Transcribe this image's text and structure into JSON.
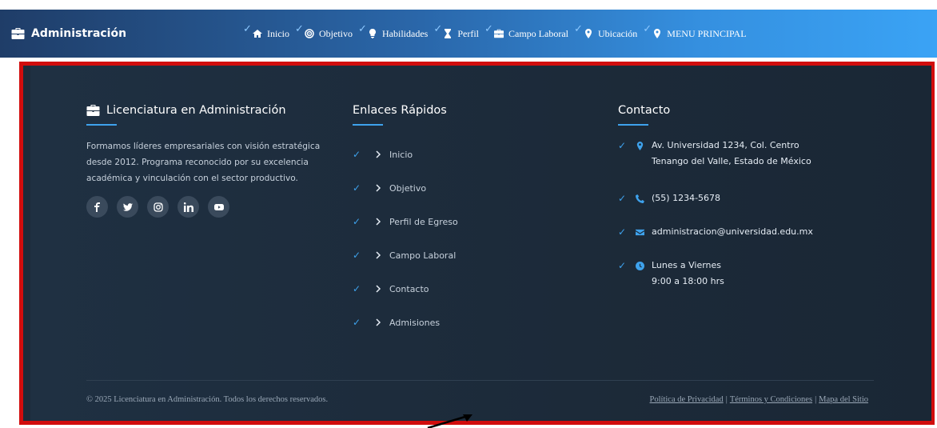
{
  "caption": {
    "text": ""
  },
  "navbar": {
    "brand": "Administración",
    "items": [
      {
        "label": "Inicio",
        "icon": "home-icon"
      },
      {
        "label": "Objetivo",
        "icon": "target-icon"
      },
      {
        "label": "Habilidades",
        "icon": "lightbulb-icon"
      },
      {
        "label": "Perfil",
        "icon": "hourglass-icon"
      },
      {
        "label": "Campo Laboral",
        "icon": "briefcase-icon"
      },
      {
        "label": "Ubicación",
        "icon": "location-pin-icon"
      },
      {
        "label": "MENU PRINCIPAL",
        "icon": "location-pin-icon"
      }
    ]
  },
  "footer": {
    "about": {
      "title": "Licenciatura en Administración",
      "text": "Formamos líderes empresariales con visión estratégica desde 2012. Programa reconocido por su excelencia académica y vinculación con el sector productivo.",
      "socials": [
        "facebook-icon",
        "twitter-icon",
        "instagram-icon",
        "linkedin-icon",
        "youtube-icon"
      ]
    },
    "links": {
      "title": "Enlaces Rápidos",
      "items": [
        "Inicio",
        "Objetivo",
        "Perfil de Egreso",
        "Campo Laboral",
        "Contacto",
        "Admisiones"
      ]
    },
    "contact": {
      "title": "Contacto",
      "address_line1": "Av. Universidad 1234, Col. Centro",
      "address_line2": "Tenango del Valle, Estado de México",
      "phone": "(55) 1234-5678",
      "email": "administracion@universidad.edu.mx",
      "hours_line1": "Lunes a Viernes",
      "hours_line2": "9:00 a 18:00 hrs"
    },
    "copyright": "© 2025 Licenciatura en Administración. Todos los derechos reservados.",
    "legal": {
      "privacy": "Política de Privacidad",
      "terms": "Términos y Condiciones",
      "sitemap": "Mapa del Sitio",
      "separator": "|"
    }
  },
  "colors": {
    "accent": "#3ea2ec",
    "frame": "#d10d0d",
    "footer_bg": "#1d2b3a"
  }
}
